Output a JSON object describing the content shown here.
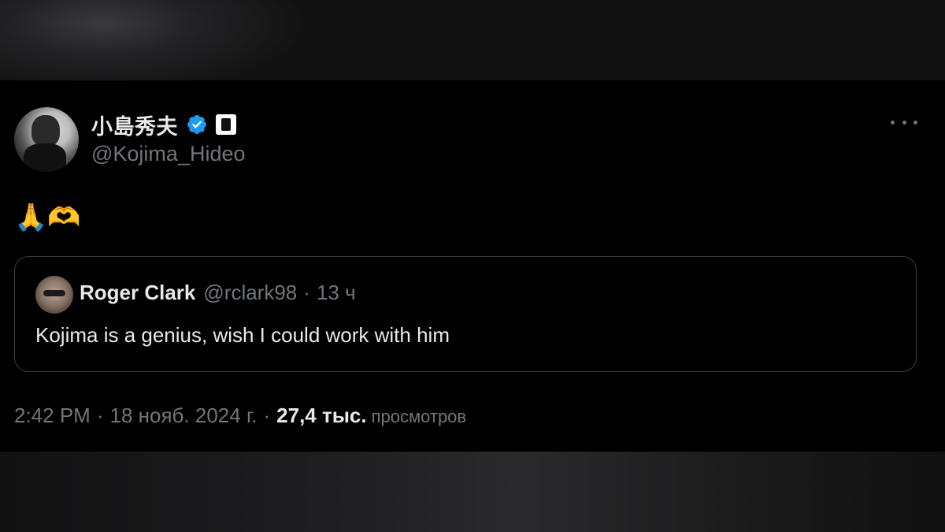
{
  "tweet": {
    "author": {
      "display_name": "小島秀夫",
      "handle": "@Kojima_Hideo",
      "verified": true
    },
    "text": "🙏🫶",
    "quoted": {
      "display_name": "Roger Clark",
      "handle": "@rclark98",
      "separator": "·",
      "time": "13 ч",
      "text": "Kojima is a genius, wish I could work with him"
    },
    "meta": {
      "time": "2:42 PM",
      "date": "18 нояб. 2024 г.",
      "separator": "·",
      "views_count": "27,4 тыс.",
      "views_label": "просмотров"
    }
  },
  "colors": {
    "background": "#000000",
    "text_primary": "#e7e9ea",
    "text_secondary": "#71767b",
    "verified_blue": "#1d9bf0",
    "border": "#3a3d40"
  },
  "icons": [
    "verified-badge-icon",
    "affiliate-badge-icon",
    "more-options-icon"
  ]
}
